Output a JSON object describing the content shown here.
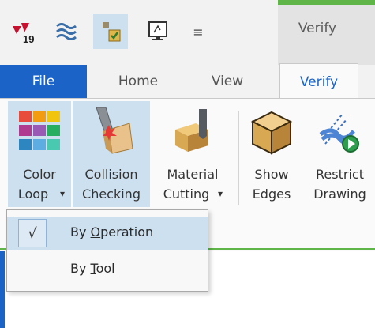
{
  "quick_access": {
    "app_icon_text": "19",
    "icons": [
      "app-logo-icon",
      "waves-icon",
      "tool-setup-icon",
      "monitor-icon",
      "customize-icon"
    ],
    "customize_glyph": "≡"
  },
  "context_tab": {
    "label": "Verify",
    "color": "#5fb548"
  },
  "tabs": [
    {
      "label": "File"
    },
    {
      "label": "Home"
    },
    {
      "label": "View"
    },
    {
      "label": "Verify"
    }
  ],
  "ribbon": {
    "color_loop": {
      "line1": "Color",
      "line2": "Loop",
      "arrow": "▾"
    },
    "collision": {
      "line1": "Collision",
      "line2": "Checking"
    },
    "material_cutting": {
      "line1": "Material",
      "line2": "Cutting",
      "arrow": "▾"
    },
    "show_edges": {
      "line1": "Show",
      "line2": "Edges"
    },
    "restrict_drawing": {
      "line1": "Restrict",
      "line2": "Drawing"
    }
  },
  "dropdown": {
    "items": [
      {
        "label_prefix": "By ",
        "label_underlined": "O",
        "label_rest": "peration",
        "checked": true,
        "check": "√"
      },
      {
        "label_prefix": "By ",
        "label_underlined": "T",
        "label_rest": "ool",
        "checked": false
      }
    ]
  },
  "colors": {
    "file_tab": "#1b63c6",
    "accent": "#1b63c6",
    "highlight": "#cde0f0"
  }
}
